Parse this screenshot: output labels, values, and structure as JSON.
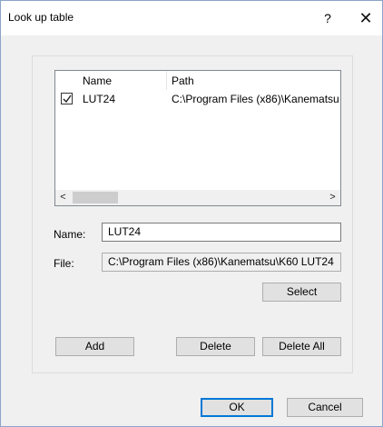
{
  "window": {
    "title": "Look up table",
    "help_label": "?",
    "close_label": "✕"
  },
  "list": {
    "columns": {
      "name": "Name",
      "path": "Path"
    },
    "rows": [
      {
        "checked": true,
        "name": "LUT24",
        "path": "C:\\Program Files (x86)\\Kanematsu"
      }
    ],
    "scroll_left": "<",
    "scroll_right": ">"
  },
  "form": {
    "name_label": "Name:",
    "name_value": "LUT24",
    "file_label": "File:",
    "file_value": "C:\\Program Files (x86)\\Kanematsu\\K60 LUT24"
  },
  "buttons": {
    "select": "Select",
    "add": "Add",
    "delete": "Delete",
    "delete_all": "Delete All",
    "ok": "OK",
    "cancel": "Cancel"
  }
}
